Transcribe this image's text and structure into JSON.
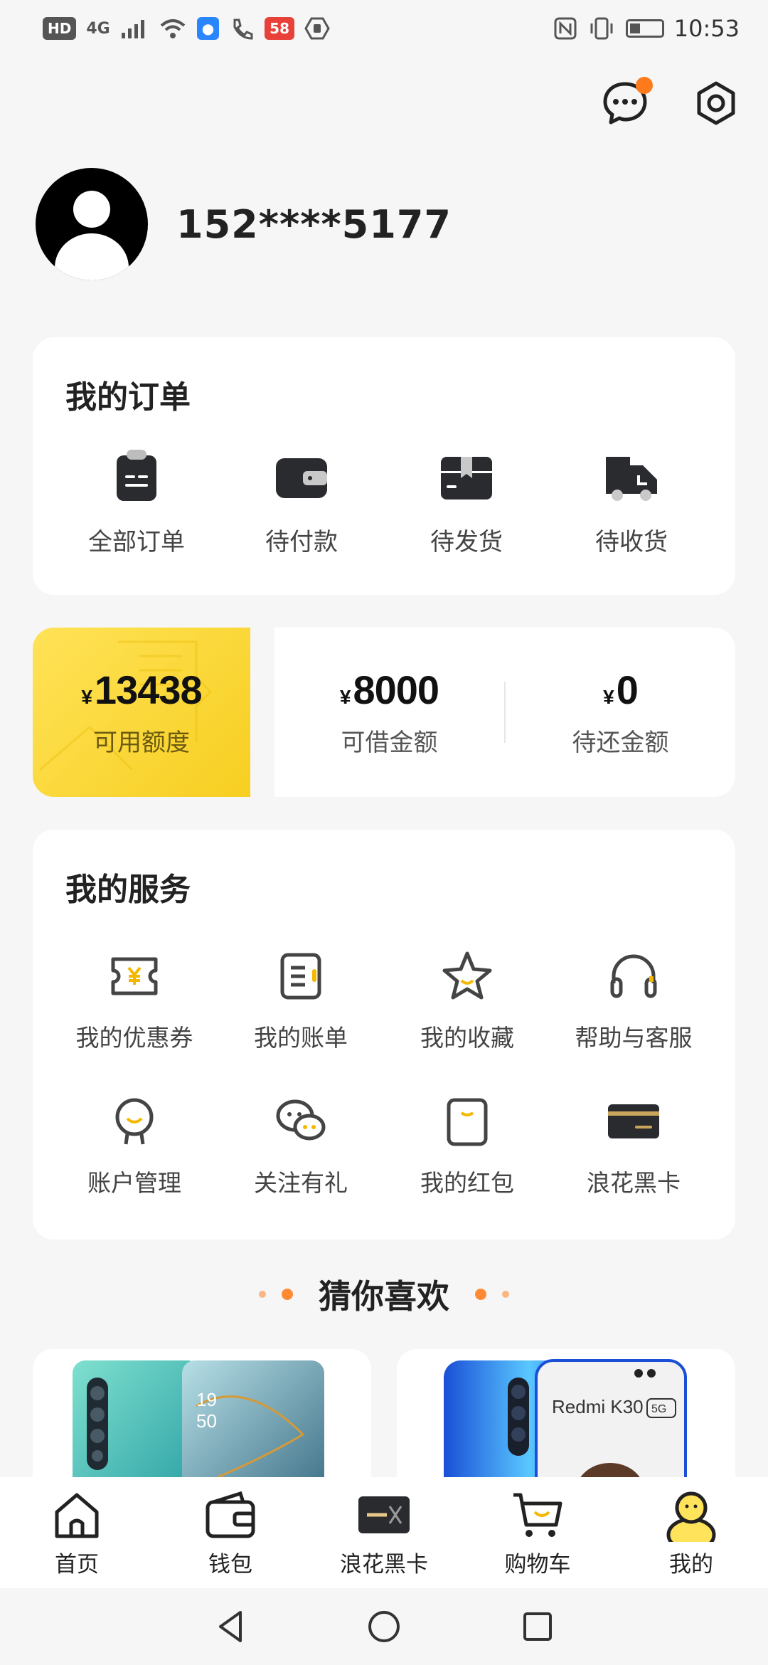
{
  "status_bar": {
    "left": [
      "HD",
      "4G",
      "58"
    ],
    "time": "10:53"
  },
  "header": {
    "message_icon": "chat-bubble-icon",
    "settings_icon": "gear-icon",
    "has_notification": true
  },
  "profile": {
    "phone": "152****5177"
  },
  "orders": {
    "title": "我的订单",
    "items": [
      {
        "label": "全部订单",
        "icon": "clipboard-icon"
      },
      {
        "label": "待付款",
        "icon": "wallet-icon"
      },
      {
        "label": "待发货",
        "icon": "box-icon"
      },
      {
        "label": "待收货",
        "icon": "truck-icon"
      }
    ]
  },
  "credit": {
    "currency": "¥",
    "available_amount": "13438",
    "available_label": "可用额度",
    "borrow_amount": "8000",
    "borrow_label": "可借金额",
    "repay_amount": "0",
    "repay_label": "待还金额"
  },
  "services": {
    "title": "我的服务",
    "items": [
      {
        "label": "我的优惠券",
        "icon": "coupon-icon"
      },
      {
        "label": "我的账单",
        "icon": "bill-icon"
      },
      {
        "label": "我的收藏",
        "icon": "star-icon"
      },
      {
        "label": "帮助与客服",
        "icon": "headset-icon"
      },
      {
        "label": "账户管理",
        "icon": "account-icon"
      },
      {
        "label": "关注有礼",
        "icon": "wechat-icon"
      },
      {
        "label": "我的红包",
        "icon": "red-packet-icon"
      },
      {
        "label": "浪花黑卡",
        "icon": "black-card-icon"
      }
    ]
  },
  "recommend": {
    "title": "猜你喜欢",
    "products": [
      {
        "screen_text": "19\n50"
      },
      {
        "screen_text": "Redmi K30",
        "badge": "5G"
      }
    ]
  },
  "tabbar": {
    "items": [
      {
        "label": "首页",
        "icon": "home-icon"
      },
      {
        "label": "钱包",
        "icon": "wallet-icon"
      },
      {
        "label": "浪花黑卡",
        "icon": "black-card-icon"
      },
      {
        "label": "购物车",
        "icon": "cart-icon"
      },
      {
        "label": "我的",
        "icon": "profile-icon",
        "active": true
      }
    ]
  },
  "colors": {
    "accent_yellow": "#f7cf21",
    "badge_orange": "#ff7a1a"
  }
}
